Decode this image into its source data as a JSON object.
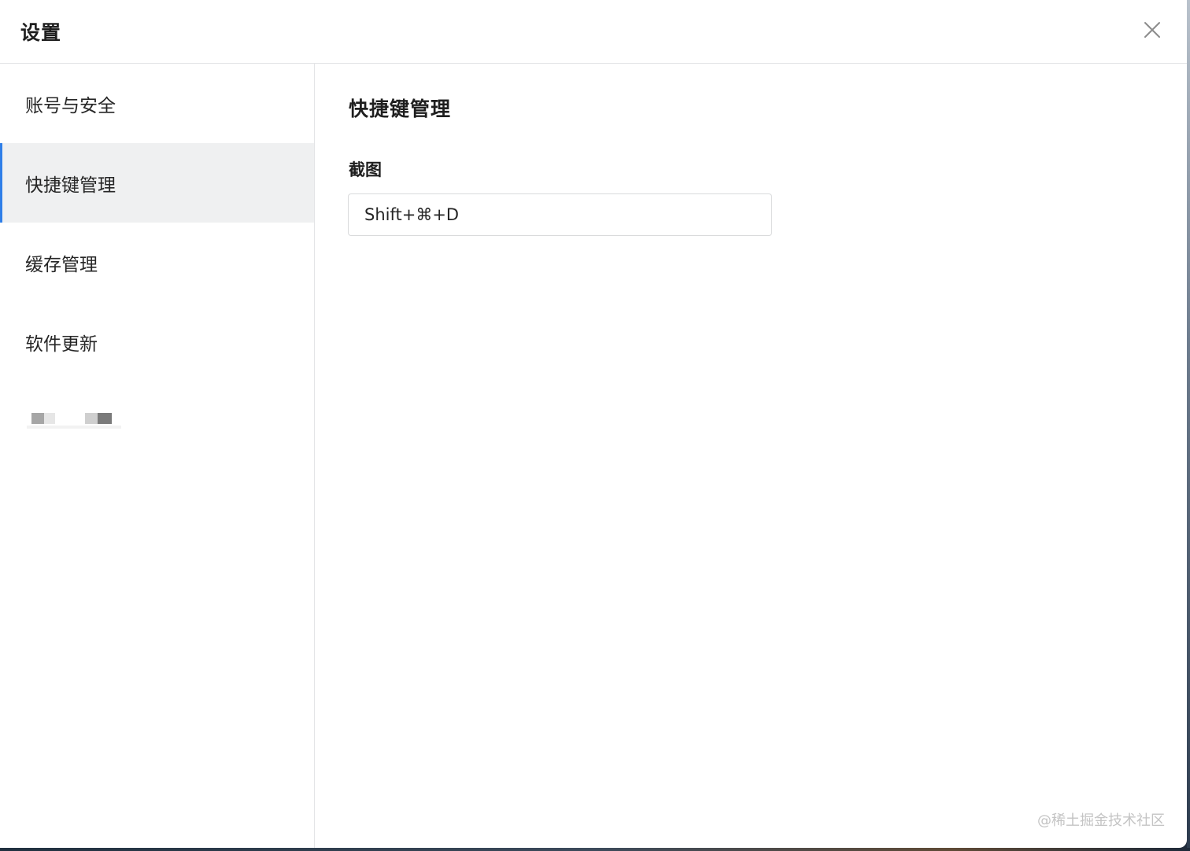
{
  "header": {
    "title": "设置",
    "close_icon": "close-icon"
  },
  "sidebar": {
    "items": [
      {
        "label": "账号与安全",
        "active": false
      },
      {
        "label": "快捷键管理",
        "active": true
      },
      {
        "label": "缓存管理",
        "active": false
      },
      {
        "label": "软件更新",
        "active": false
      }
    ]
  },
  "content": {
    "section_title": "快捷键管理",
    "screenshot_label": "截图",
    "screenshot_shortcut": "Shift+⌘+D"
  },
  "watermark": "@稀土掘金技术社区",
  "colors": {
    "accent": "#2f7fe8",
    "active_bg": "#eff0f1",
    "border": "#e3e4e6"
  }
}
